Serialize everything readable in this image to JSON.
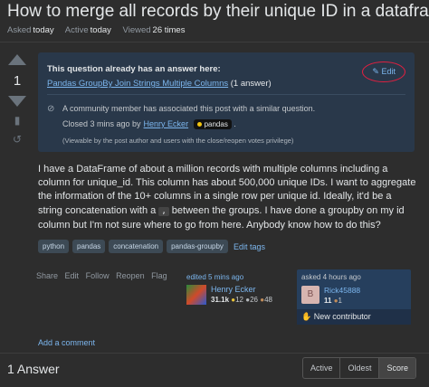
{
  "question": {
    "title": "How to merge all records by their unique ID in a dataframe? [d",
    "asked_label": "Asked",
    "asked_value": "today",
    "active_label": "Active",
    "active_value": "today",
    "viewed_label": "Viewed",
    "viewed_value": "26 times"
  },
  "vote": {
    "score": "1"
  },
  "notice": {
    "heading": "This question already has an answer here:",
    "edit_label": "Edit",
    "duplicate_link": "Pandas GroupBy Join Strings Multiple Columns",
    "duplicate_count": "(1 answer)",
    "community_text": "A community member has associated this post with a similar question.",
    "closed_text": "Closed 3 mins ago by",
    "closer_name": "Henry Ecker",
    "closer_tag": "pandas",
    "viewable_text": "(Viewable by the post author and users with the close/reopen votes privilege)"
  },
  "body": {
    "part1": "I have a DataFrame of about a million records with multiple columns including a column for unique_id. This column has about 500,000 unique IDs. I want to aggregate the information of the 10+ columns in a single row per unique id. Ideally, it'd be a string concatenation with a ",
    "code": ",",
    "part2": " between the groups. I have done a groupby on my id column but I'm not sure where to go from here. Anybody know how to do this?"
  },
  "tags": [
    "python",
    "pandas",
    "concatenation",
    "pandas-groupby"
  ],
  "edit_tags": "Edit tags",
  "actions": [
    "Share",
    "Edit",
    "Follow",
    "Reopen",
    "Flag"
  ],
  "editor": {
    "when": "edited 5 mins ago",
    "name": "Henry Ecker",
    "rep": "31.1k",
    "gold": "12",
    "silver": "26",
    "bronze": "48"
  },
  "asker": {
    "when": "asked 4 hours ago",
    "initial": "B",
    "name": "Rick45888",
    "rep": "11",
    "bronze": "1",
    "new_contributor": "New contributor"
  },
  "add_comment": "Add a comment",
  "answers_header": "1 Answer",
  "sort": [
    "Active",
    "Oldest",
    "Score"
  ]
}
